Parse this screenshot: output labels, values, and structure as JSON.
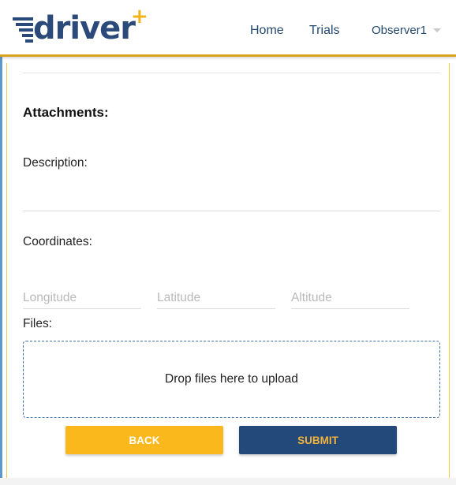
{
  "header": {
    "logo_text": "driver",
    "logo_plus": "+",
    "nav": {
      "home": "Home",
      "trials": "Trials",
      "user": "Observer1"
    }
  },
  "form": {
    "heading": "Attachments:",
    "description_label": "Description:",
    "coordinates_label": "Coordinates:",
    "longitude_placeholder": "Longitude",
    "latitude_placeholder": "Latitude",
    "altitude_placeholder": "Altitude",
    "files_label": "Files:",
    "dropzone_text": "Drop files here to upload"
  },
  "buttons": {
    "back": "BACK",
    "submit": "SUBMIT"
  },
  "colors": {
    "brand_blue": "#2b4a7a",
    "accent_yellow": "#fbb81c",
    "submit_bg": "#23497a",
    "submit_text": "#f4b23b"
  }
}
